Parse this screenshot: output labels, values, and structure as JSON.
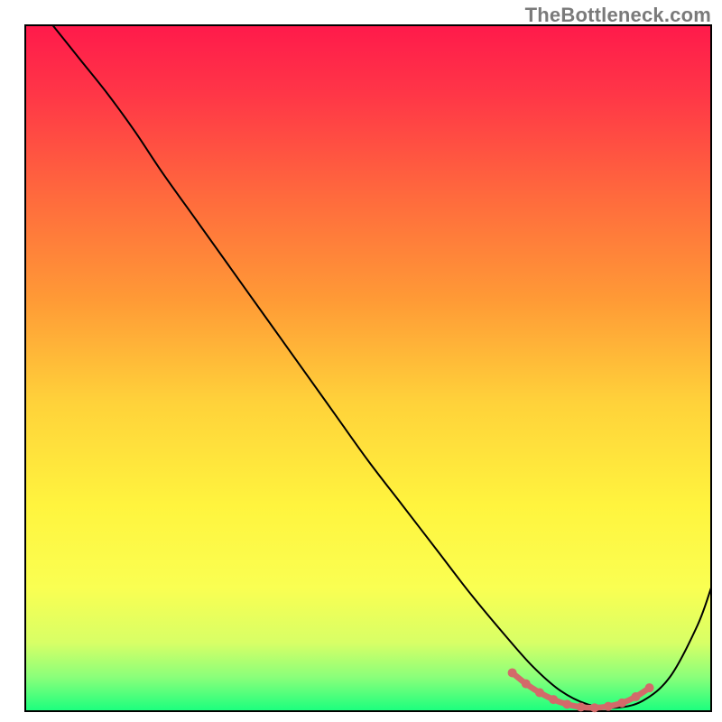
{
  "watermark": "TheBottleneck.com",
  "chart_data": {
    "type": "line",
    "title": "",
    "xlabel": "",
    "ylabel": "",
    "xlim": [
      0,
      100
    ],
    "ylim": [
      0,
      100
    ],
    "background_gradient": {
      "stops": [
        {
          "offset": 0.0,
          "color": "#ff1a4b"
        },
        {
          "offset": 0.1,
          "color": "#ff3647"
        },
        {
          "offset": 0.25,
          "color": "#ff6a3d"
        },
        {
          "offset": 0.4,
          "color": "#ff9a36"
        },
        {
          "offset": 0.55,
          "color": "#ffd23a"
        },
        {
          "offset": 0.7,
          "color": "#fff43e"
        },
        {
          "offset": 0.82,
          "color": "#faff52"
        },
        {
          "offset": 0.9,
          "color": "#d8ff66"
        },
        {
          "offset": 0.95,
          "color": "#8bff7a"
        },
        {
          "offset": 1.0,
          "color": "#1aff7e"
        }
      ]
    },
    "series": [
      {
        "name": "bottleneck-curve",
        "color": "#000000",
        "stroke_width": 2,
        "x": [
          4,
          8,
          12,
          16,
          20,
          25,
          30,
          35,
          40,
          45,
          50,
          55,
          60,
          65,
          70,
          74,
          78,
          82,
          86,
          90,
          94,
          98,
          100
        ],
        "y": [
          100,
          95,
          90,
          84.5,
          78.5,
          71.5,
          64.5,
          57.5,
          50.5,
          43.5,
          36.5,
          30,
          23.5,
          17,
          11,
          6.5,
          3,
          1,
          0.5,
          1.5,
          5,
          12.5,
          18
        ]
      },
      {
        "name": "optimal-range-marker",
        "color": "#d36a6a",
        "stroke_width": 10,
        "x": [
          71,
          73,
          75,
          77,
          79,
          81,
          83,
          85,
          87,
          89,
          91
        ],
        "y": [
          5.6,
          4.0,
          2.7,
          1.7,
          1.0,
          0.6,
          0.5,
          0.7,
          1.2,
          2.1,
          3.4
        ]
      }
    ]
  }
}
